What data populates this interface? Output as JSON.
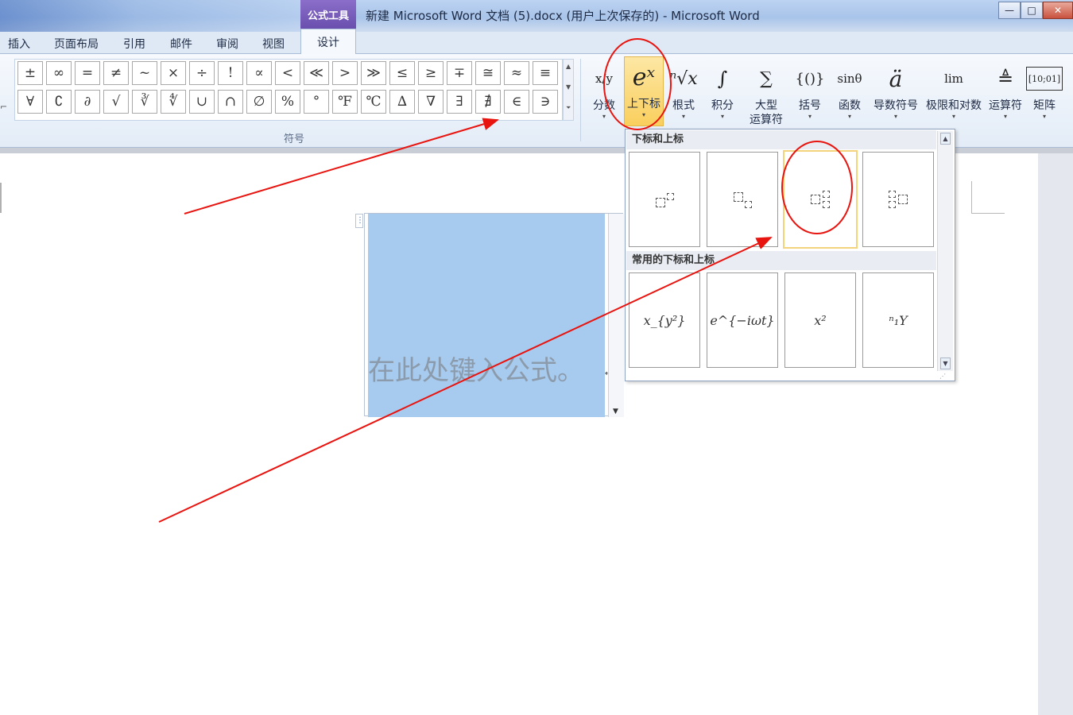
{
  "window": {
    "title": "新建 Microsoft Word 文档 (5).docx (用户上次保存的) - Microsoft Word",
    "context_tab": "公式工具",
    "buttons": [
      "—",
      "□",
      "✕"
    ]
  },
  "tabs": [
    "插入",
    "页面布局",
    "引用",
    "邮件",
    "审阅",
    "视图"
  ],
  "active_tab": "设计",
  "symbols": {
    "row1": [
      "±",
      "∞",
      "=",
      "≠",
      "~",
      "×",
      "÷",
      "!",
      "∝",
      "<",
      "≪",
      ">",
      "≫",
      "≤",
      "≥",
      "∓",
      "≅",
      "≈",
      "≡"
    ],
    "row2": [
      "∀",
      "∁",
      "∂",
      "√",
      "∛",
      "∜",
      "∪",
      "∩",
      "∅",
      "%",
      "°",
      "℉",
      "℃",
      "∆",
      "∇",
      "∃",
      "∄",
      "∈",
      "∋"
    ],
    "group_label": "符号"
  },
  "structures": [
    {
      "label": "分数",
      "icon": "fraction-icon"
    },
    {
      "label": "上下标",
      "icon": "script-icon"
    },
    {
      "label": "根式",
      "icon": "radical-icon"
    },
    {
      "label": "积分",
      "icon": "integral-icon"
    },
    {
      "label": "大型\n运算符",
      "icon": "large-operator-icon"
    },
    {
      "label": "括号",
      "icon": "bracket-icon"
    },
    {
      "label": "函数",
      "icon": "function-icon"
    },
    {
      "label": "导数符号",
      "icon": "accent-icon"
    },
    {
      "label": "极限和对数",
      "icon": "limit-icon"
    },
    {
      "label": "运算符",
      "icon": "operator-icon"
    },
    {
      "label": "矩阵",
      "icon": "matrix-icon"
    }
  ],
  "structure_icons": {
    "fraction": "x/y",
    "script": "eˣ",
    "radical": "ⁿ√x",
    "integral": "∫",
    "large_op": "∑",
    "bracket": "{()}",
    "function": "sinθ",
    "accent": "ä",
    "limit": "lim",
    "operator": "≜",
    "matrix": "[10;01]"
  },
  "equation": {
    "placeholder": "在此处键入公式。"
  },
  "dropdown": {
    "section1_title": "下标和上标",
    "section2_title": "常用的下标和上标",
    "common": [
      "x_{y²}",
      "e^{−iωt}",
      "x²",
      "ⁿ₁Y"
    ]
  },
  "colors": {
    "highlight": "#f9cf5d",
    "equation_fill": "#a7cbef",
    "annotation": "#e8140f",
    "context_tab": "#6a4fae"
  }
}
